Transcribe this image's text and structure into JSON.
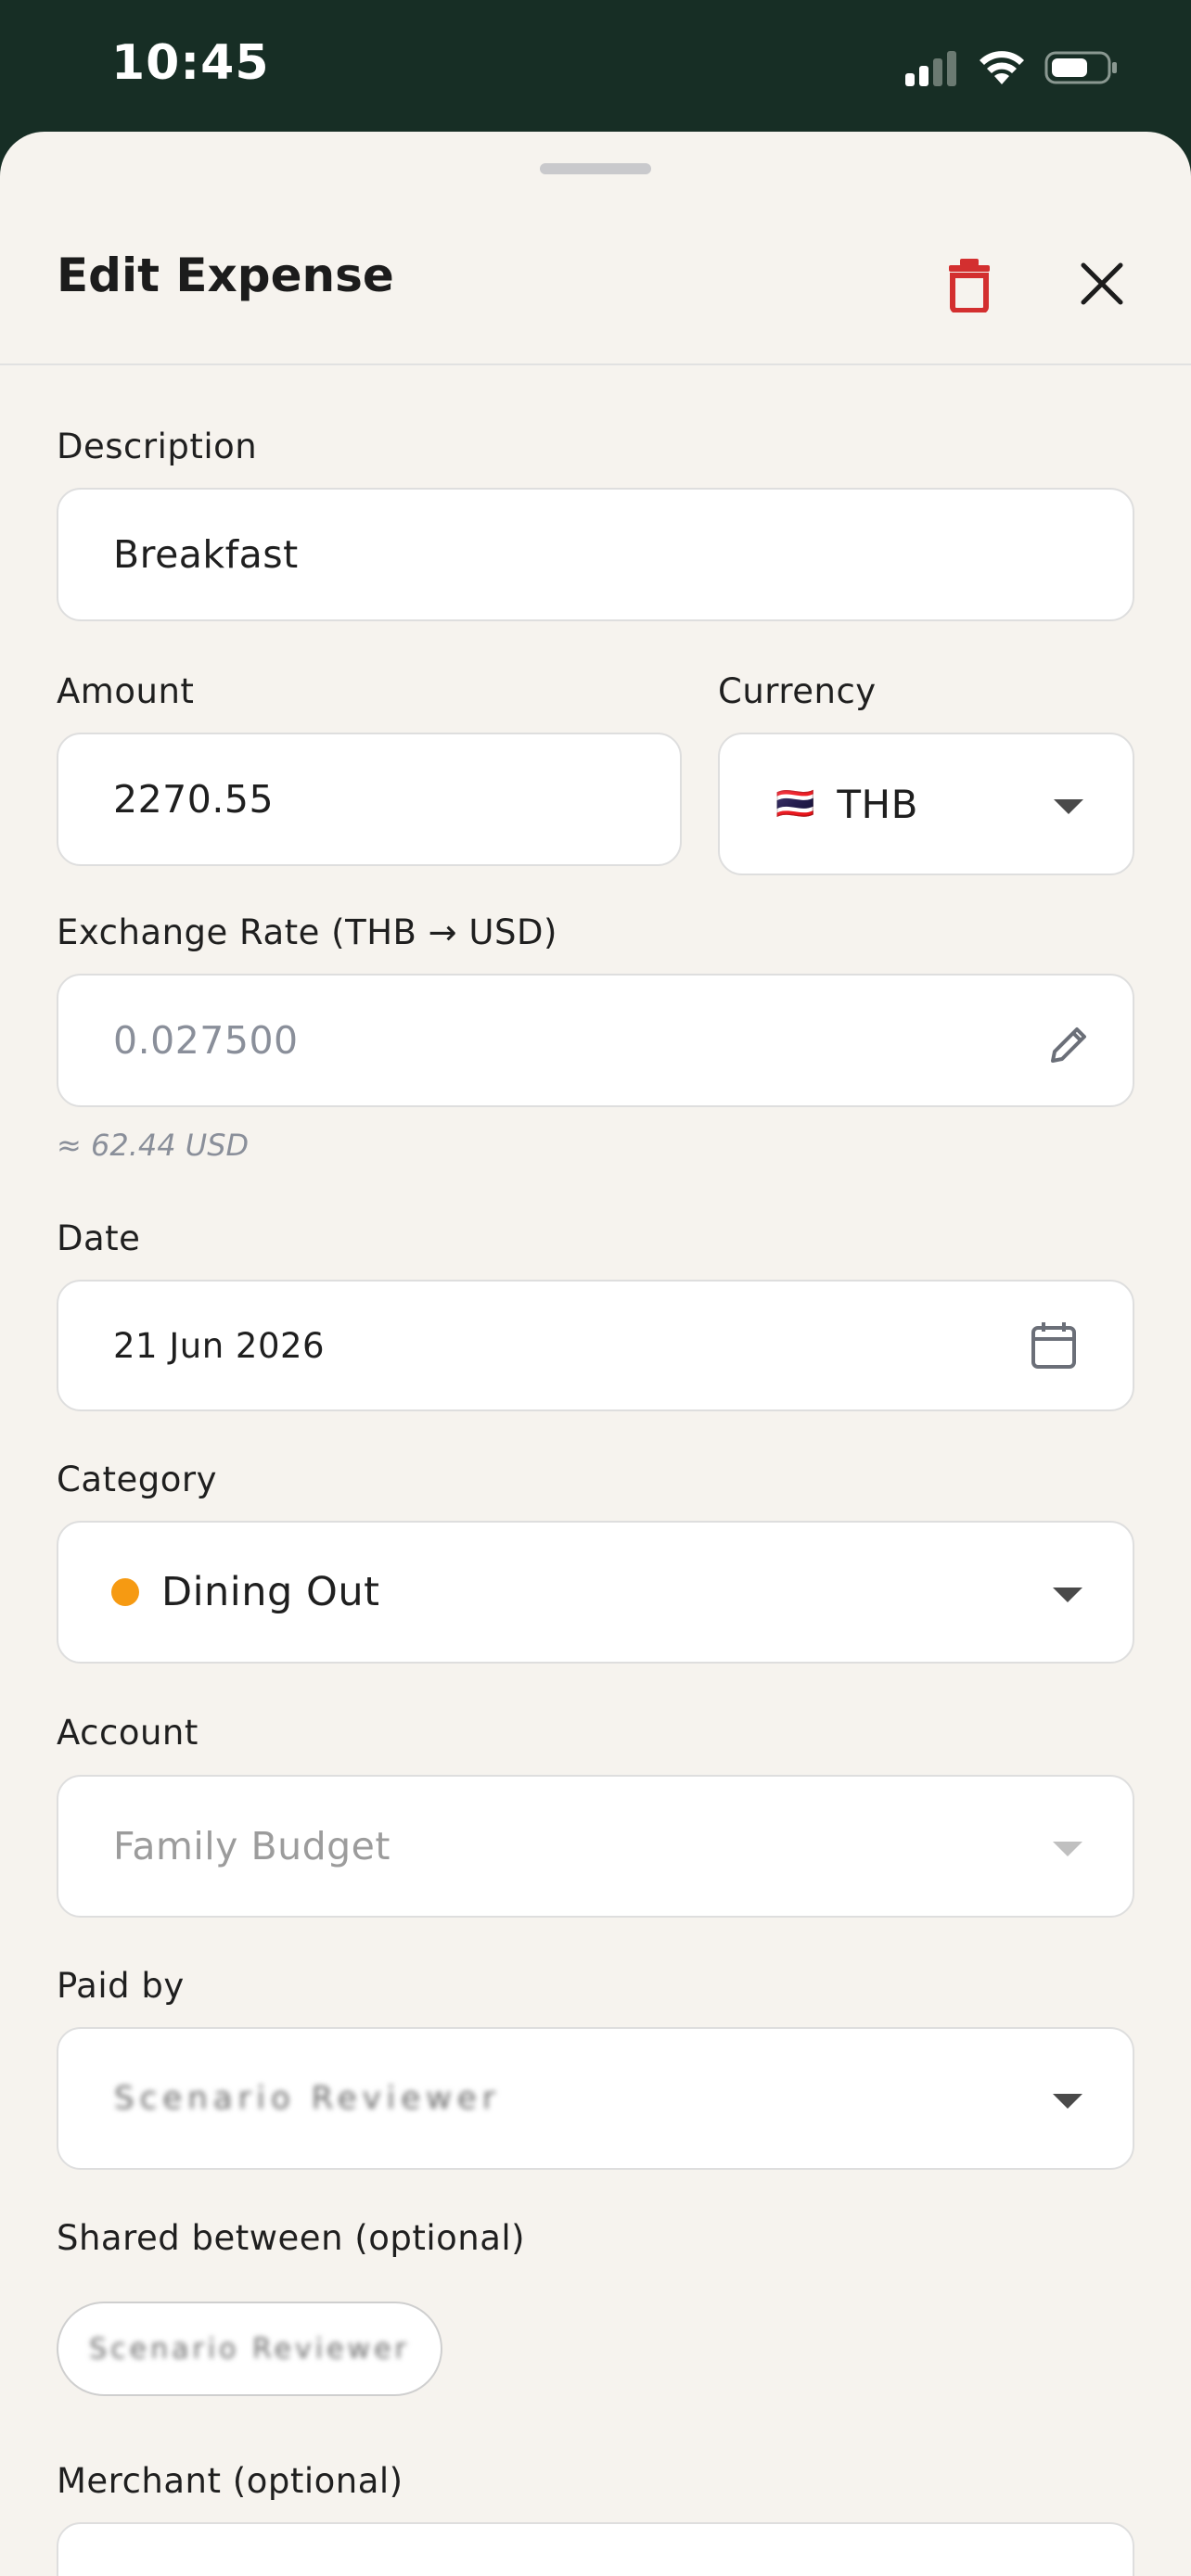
{
  "status_bar": {
    "time": "10:45",
    "icons": [
      "signal-icon",
      "wifi-icon",
      "battery-icon"
    ]
  },
  "header": {
    "title": "Edit Expense",
    "delete_icon": "trash-icon",
    "close_icon": "close-icon",
    "delete_color": "#d32f2f"
  },
  "form": {
    "description": {
      "label": "Description",
      "value": "Breakfast"
    },
    "amount": {
      "label": "Amount",
      "value": "2270.55"
    },
    "currency": {
      "label": "Currency",
      "flag": "🇹🇭",
      "value": "THB"
    },
    "exchange_rate": {
      "label": "Exchange Rate (THB → USD)",
      "value": "0.027500",
      "hint": "≈ 62.44 USD",
      "icon": "pencil-icon"
    },
    "date": {
      "label": "Date",
      "value": "21 Jun 2026",
      "icon": "calendar-icon"
    },
    "category": {
      "label": "Category",
      "value": "Dining Out",
      "color": "#f69a12"
    },
    "account": {
      "label": "Account",
      "value": "Family Budget"
    },
    "paid_by": {
      "label": "Paid by",
      "value": "Scenario Reviewer"
    },
    "shared_between": {
      "label": "Shared between (optional)",
      "chip": "Scenario Reviewer"
    },
    "merchant": {
      "label": "Merchant (optional)"
    }
  }
}
